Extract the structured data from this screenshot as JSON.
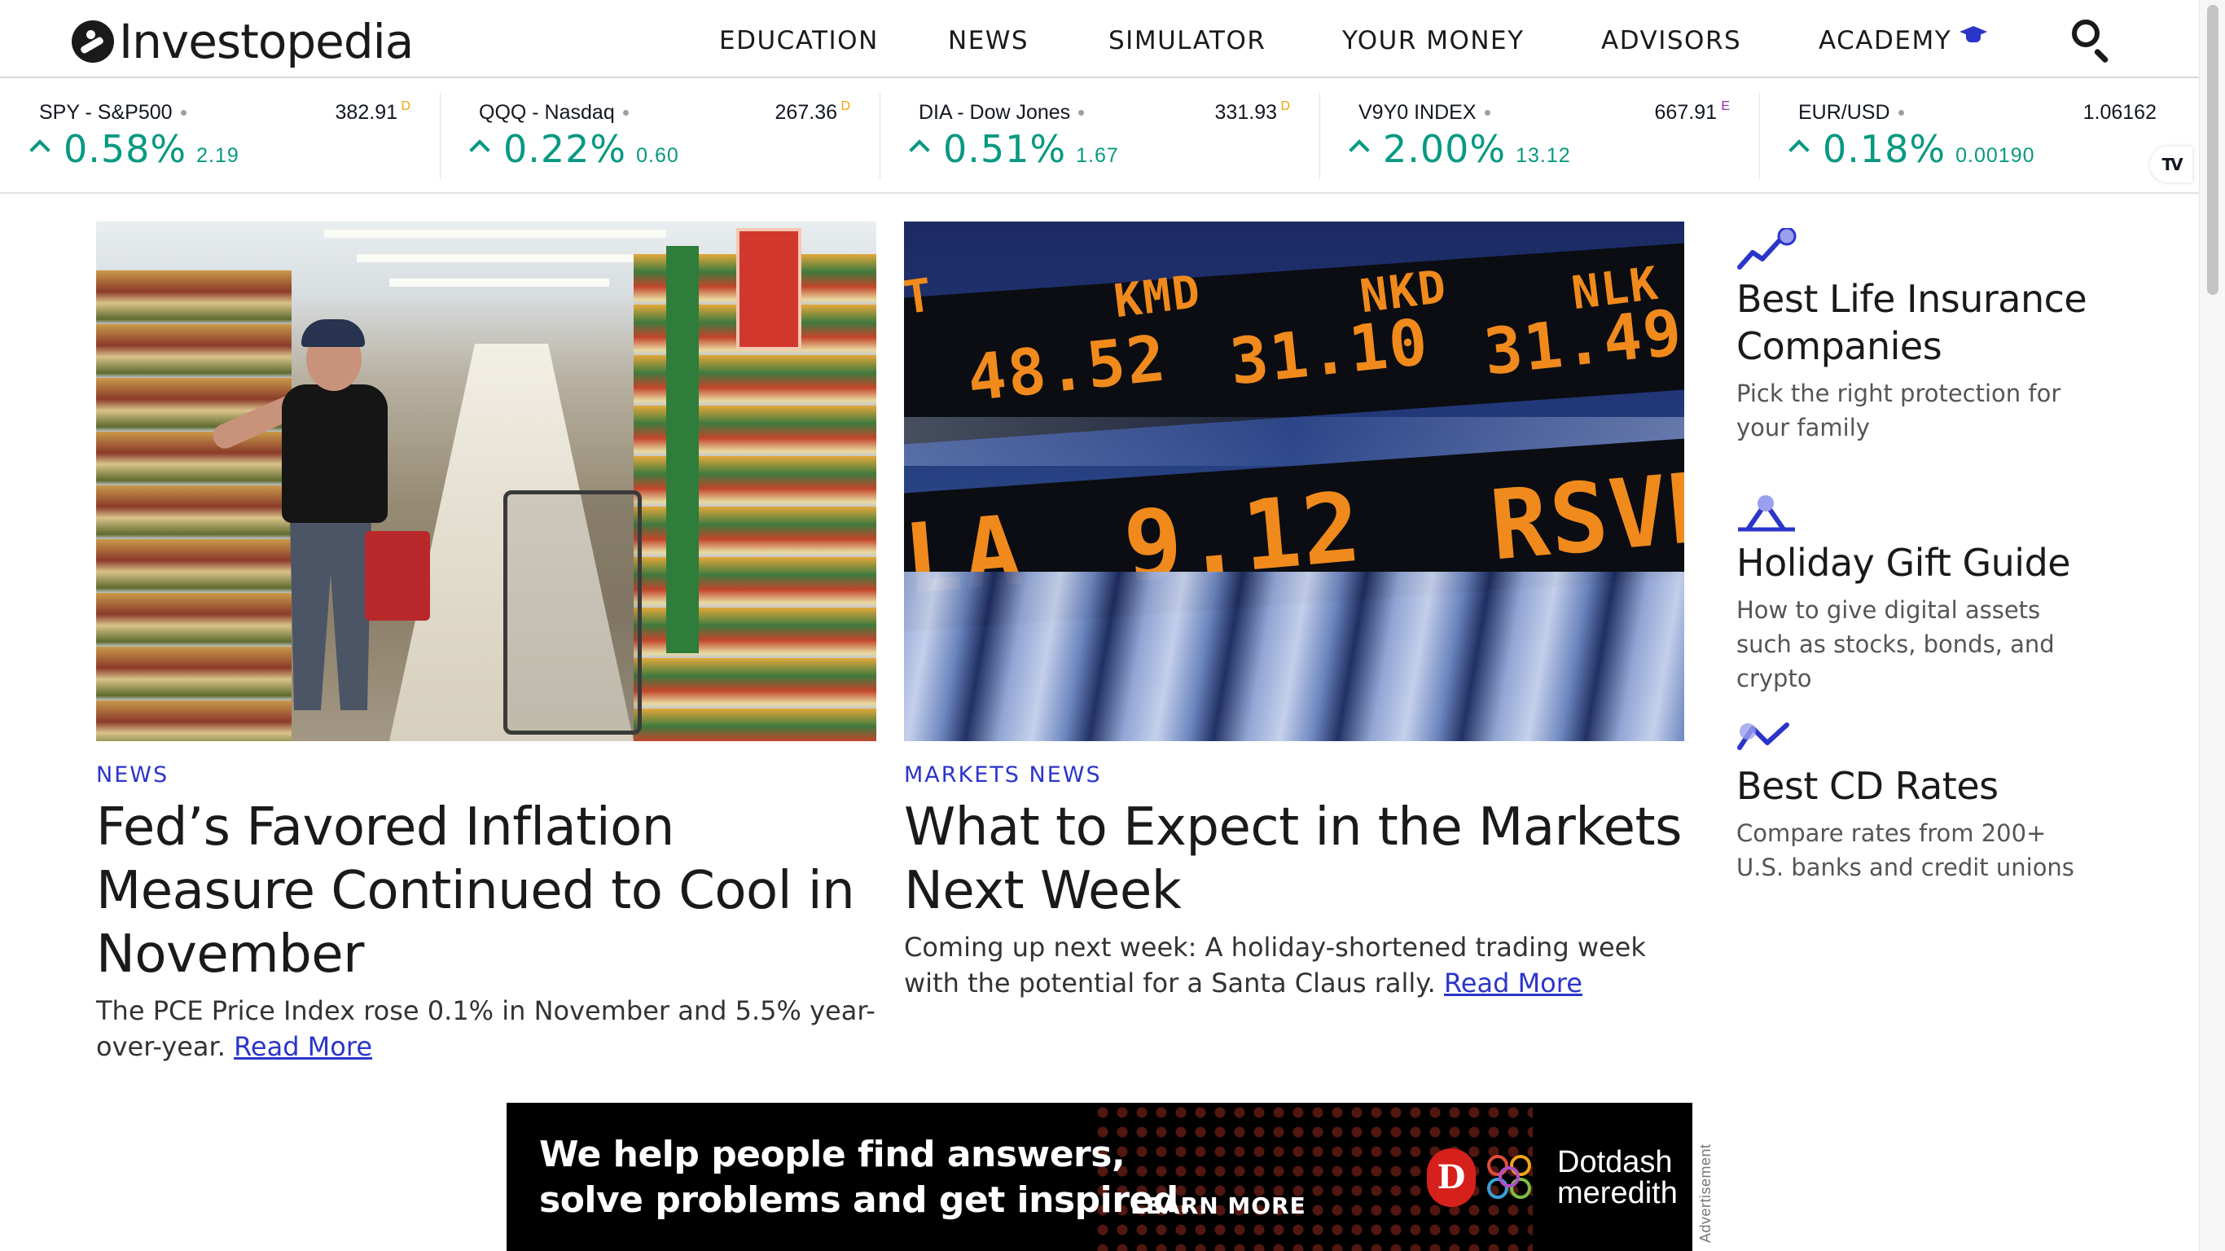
{
  "brand": {
    "name": "Investopedia"
  },
  "nav": [
    {
      "label": "EDUCATION"
    },
    {
      "label": "NEWS"
    },
    {
      "label": "SIMULATOR"
    },
    {
      "label": "YOUR MONEY"
    },
    {
      "label": "ADVISORS"
    },
    {
      "label": "ACADEMY"
    }
  ],
  "ticker": [
    {
      "name": "SPY - S&P500",
      "price": "382.91",
      "flag": "D",
      "pct": "0.58%",
      "chg": "2.19"
    },
    {
      "name": "QQQ - Nasdaq",
      "price": "267.36",
      "flag": "D",
      "pct": "0.22%",
      "chg": "0.60"
    },
    {
      "name": "DIA - Dow Jones",
      "price": "331.93",
      "flag": "D",
      "pct": "0.51%",
      "chg": "1.67"
    },
    {
      "name": "V9Y0 INDEX",
      "price": "667.91",
      "flag": "E",
      "pct": "2.00%",
      "chg": "13.12"
    },
    {
      "name": "EUR/USD",
      "price": "1.06162",
      "flag": "",
      "pct": "0.18%",
      "chg": "0.00190"
    }
  ],
  "tradingview": {
    "logo": "TV"
  },
  "articles": [
    {
      "category": "NEWS",
      "headline": "Fed’s Favored Inflation Measure Continued to Cool in November",
      "summary": "The PCE Price Index rose 0.1% in November and 5.5% year-over-year.",
      "read_more": "Read More"
    },
    {
      "category": "MARKETS NEWS",
      "headline": "What to Expect in the Markets Next Week",
      "summary": "Coming up next week: A holiday-shortened trading week with the potential for a Santa Claus rally.",
      "read_more": "Read More"
    }
  ],
  "photo_markets": {
    "row1": [
      "T",
      "KMD",
      "NKD",
      "NLK"
    ],
    "row2": [
      "48.52",
      "31.10",
      "31.49"
    ],
    "row3": [
      "LA",
      "9.12",
      "RSVN"
    ]
  },
  "sidebar": [
    {
      "title": "Best Life Insurance Companies",
      "desc": "Pick the right protection for your family",
      "icon": "trend-up-icon"
    },
    {
      "title": "Holiday Gift Guide",
      "desc": "How to give digital assets such as stocks, bonds, and crypto",
      "icon": "peak-icon"
    },
    {
      "title": "Best CD Rates",
      "desc": "Compare rates from 200+ U.S. banks and credit unions",
      "icon": "zigzag-icon"
    }
  ],
  "ad": {
    "line1": "We help people find answers,",
    "line2": "solve problems and get inspired.",
    "cta": "LEARN MORE",
    "brand_line1": "Dotdash",
    "brand_line2": "meredith",
    "logo_letter": "D",
    "label": "Advertisement"
  },
  "colors": {
    "accent": "#2c35c9",
    "positive": "#089981",
    "flag_d": "#f0a30a",
    "flag_e": "#9c27b0"
  }
}
